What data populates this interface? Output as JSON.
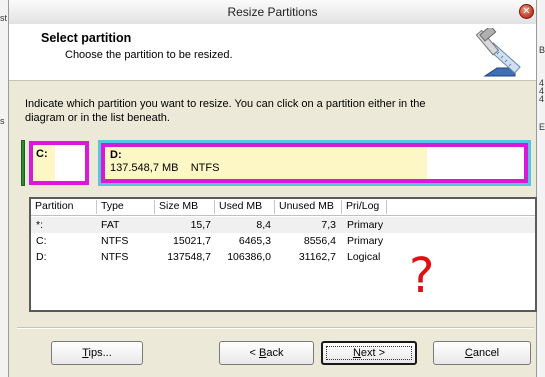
{
  "window": {
    "title": "Resize Partitions",
    "close_glyph": "✕"
  },
  "header": {
    "title": "Select partition",
    "subtitle": "Choose the partition to be resized.",
    "icon": "resize-tools-icon"
  },
  "instruction": "Indicate which partition you want to resize. You can click on a partition either in the diagram or in the list beneath.",
  "diagram": {
    "partitions": [
      {
        "label": "C:",
        "info": ""
      },
      {
        "label": "D:",
        "info": "137.548,7 MB    NTFS"
      }
    ],
    "colors": {
      "border": "#d81ad8",
      "used": "#fdf7c6",
      "selected": "#58c5e0",
      "bar": "#2b8a2b"
    }
  },
  "list": {
    "columns": [
      "Partition",
      "Type",
      "Size MB",
      "Used MB",
      "Unused MB",
      "Pri/Log"
    ],
    "rows": [
      [
        "*:",
        "FAT",
        "15,7",
        "8,4",
        "7,3",
        "Primary"
      ],
      [
        "C:",
        "NTFS",
        "15021,7",
        "6465,3",
        "8556,4",
        "Primary"
      ],
      [
        "D:",
        "NTFS",
        "137548,7",
        "106386,0",
        "31162,7",
        "Logical"
      ]
    ]
  },
  "annotation": "?",
  "buttons": {
    "tips": {
      "pre": "",
      "mnemonic": "T",
      "post": "ips..."
    },
    "back": {
      "pre": "< ",
      "mnemonic": "B",
      "post": "ack"
    },
    "next": {
      "pre": "",
      "mnemonic": "N",
      "post": "ext >"
    },
    "cancel": {
      "pre": "",
      "mnemonic": "C",
      "post": "ancel"
    }
  },
  "background": {
    "left_fragments": [
      "st",
      "s"
    ],
    "right_fragments": [
      "B",
      "4",
      "4",
      "4",
      "E"
    ]
  }
}
